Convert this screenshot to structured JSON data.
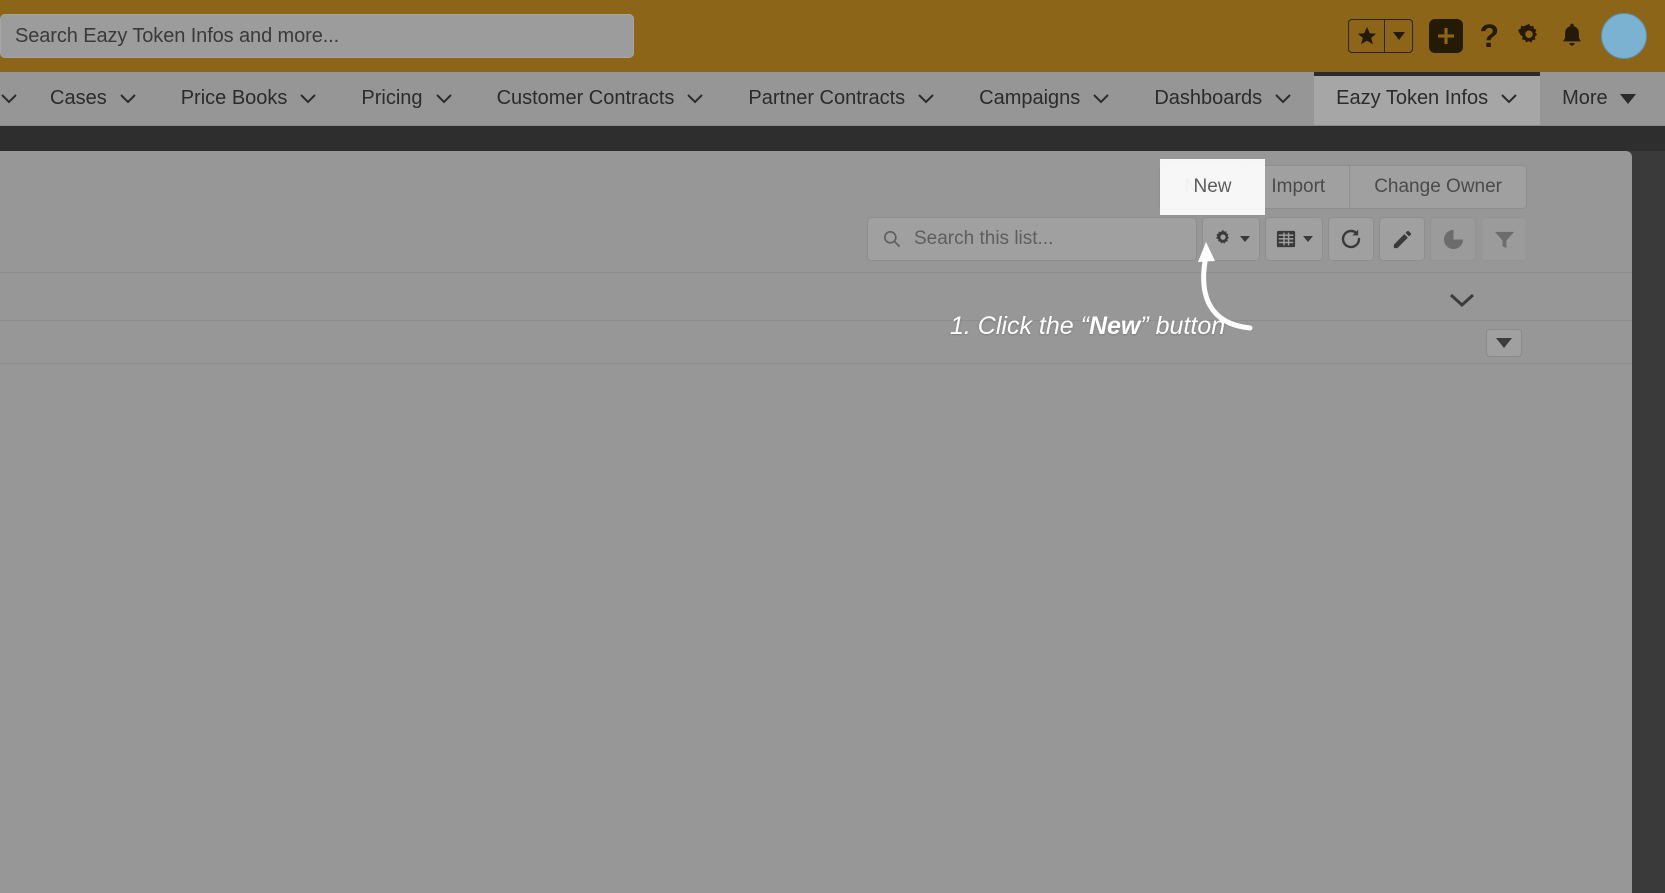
{
  "global_header": {
    "search": {
      "placeholder": "Search Eazy Token Infos and more...",
      "icon": "search-icon"
    },
    "icons": [
      {
        "name": "favorites-star-icon",
        "glyph": "★"
      },
      {
        "name": "favorites-caret-icon",
        "glyph": "▾"
      },
      {
        "name": "global-add-icon",
        "glyph": "+"
      },
      {
        "name": "help-icon",
        "glyph": "?"
      },
      {
        "name": "setup-gear-icon",
        "glyph": "gear"
      },
      {
        "name": "notifications-bell-icon",
        "glyph": "bell"
      },
      {
        "name": "user-avatar",
        "glyph": "avatar"
      }
    ]
  },
  "nav": {
    "items": [
      {
        "label": "",
        "partial": true,
        "has_caret": true
      },
      {
        "label": "Cases",
        "has_caret": true
      },
      {
        "label": "Price Books",
        "has_caret": true
      },
      {
        "label": "Pricing",
        "has_caret": true
      },
      {
        "label": "Customer Contracts",
        "has_caret": true
      },
      {
        "label": "Partner Contracts",
        "has_caret": true
      },
      {
        "label": "Campaigns",
        "has_caret": true
      },
      {
        "label": "Dashboards",
        "has_caret": true
      },
      {
        "label": "Eazy Token Infos",
        "has_caret": true,
        "active": true
      },
      {
        "label": "More",
        "has_caret": true
      }
    ],
    "edit_icon": "pencil-icon"
  },
  "page_actions": {
    "new_label": "New",
    "import_label": "Import",
    "change_owner_label": "Change Owner"
  },
  "list_toolbar": {
    "search_placeholder": "Search this list...",
    "buttons": [
      {
        "name": "list-view-controls-gear",
        "icon": "gear-icon",
        "has_caret": true
      },
      {
        "name": "display-as-table",
        "icon": "table-icon",
        "has_caret": true
      },
      {
        "name": "refresh-list",
        "icon": "refresh-icon",
        "has_caret": false
      },
      {
        "name": "edit-list",
        "icon": "pencil-icon",
        "has_caret": false
      },
      {
        "name": "list-chart",
        "icon": "chart-icon",
        "has_caret": false,
        "disabled": true
      },
      {
        "name": "list-filters",
        "icon": "filter-icon",
        "has_caret": false,
        "disabled": true
      }
    ]
  },
  "annotation": {
    "prefix": "1. Click the “",
    "bold": "New",
    "suffix": "” button"
  },
  "colors": {
    "header_brand": "#8c6518",
    "nav_bg": "#969696",
    "content_bg": "#979797",
    "overlay_dark": "#3a3a3a",
    "avatar": "#7cb2d1",
    "highlight": "#ffffff"
  }
}
